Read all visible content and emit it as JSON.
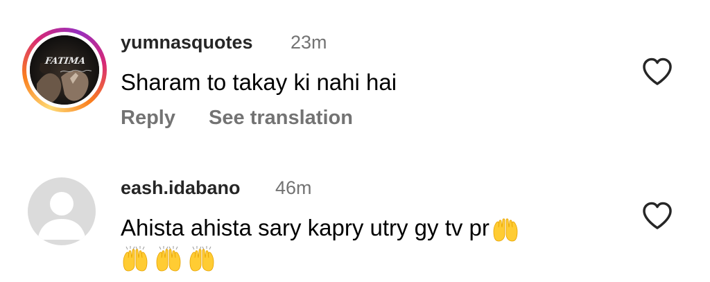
{
  "comments": [
    {
      "username": "yumnasquotes",
      "time": "23m",
      "text": "Sharam to takay ki nahi hai",
      "avatar_logo_text": "FATIMA",
      "actions": {
        "reply": "Reply",
        "translate": "See translation"
      },
      "like_icon": "heart-outline-icon"
    },
    {
      "username": "eash.idabano",
      "time": "46m",
      "text": "Ahista ahista sary kapry utry gy tv pr",
      "emoji_count_inline": 1,
      "emoji_count_next_line": 3,
      "emoji_icon": "raising-hands-emoji",
      "like_icon": "heart-outline-icon"
    }
  ],
  "colors": {
    "username": "#262626",
    "timestamp": "#737373",
    "action": "#737373",
    "avatar_placeholder": "#dbdbdb"
  }
}
